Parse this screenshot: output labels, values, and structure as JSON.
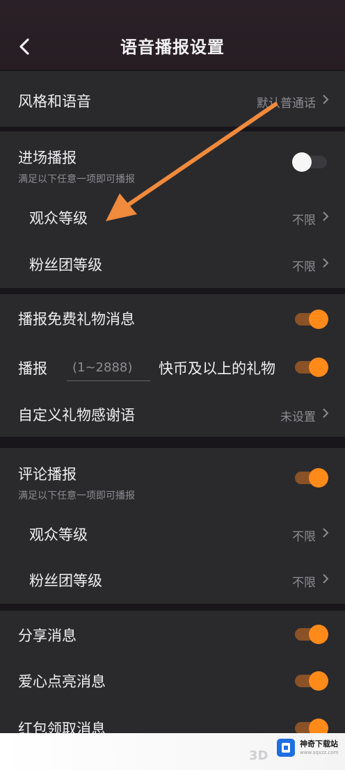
{
  "header": {
    "title": "语音播报设置"
  },
  "style_voice": {
    "label": "风格和语音",
    "value": "默认普通话"
  },
  "entry": {
    "label": "进场播报",
    "hint": "满足以下任意一项即可播报",
    "toggle_on": false,
    "viewer_level": {
      "label": "观众等级",
      "value": "不限"
    },
    "fan_level": {
      "label": "粉丝团等级",
      "value": "不限"
    }
  },
  "gifts": {
    "free_gift": {
      "label": "播报免费礼物消息",
      "toggle_on": true
    },
    "paid_gift": {
      "prefix": "播报",
      "placeholder": "(1~2888)",
      "suffix": "快币及以上的礼物",
      "toggle_on": true
    },
    "thanks": {
      "label": "自定义礼物感谢语",
      "value": "未设置"
    }
  },
  "comment": {
    "label": "评论播报",
    "hint": "满足以下任意一项即可播报",
    "toggle_on": true,
    "viewer_level": {
      "label": "观众等级",
      "value": "不限"
    },
    "fan_level": {
      "label": "粉丝团等级",
      "value": "不限"
    }
  },
  "misc": {
    "share": {
      "label": "分享消息",
      "toggle_on": true
    },
    "heart": {
      "label": "爱心点亮消息",
      "toggle_on": true
    },
    "red_packet": {
      "label": "红包领取消息",
      "toggle_on": true
    }
  },
  "watermark": {
    "brand": "神奇下载站",
    "brand_sub": "www.sqxzz.com",
    "mark": "3D"
  },
  "colors": {
    "accent": "#ff8a1a",
    "arrow": "#f08a3c",
    "background": "#18161a",
    "panel": "#2a2a2d"
  }
}
